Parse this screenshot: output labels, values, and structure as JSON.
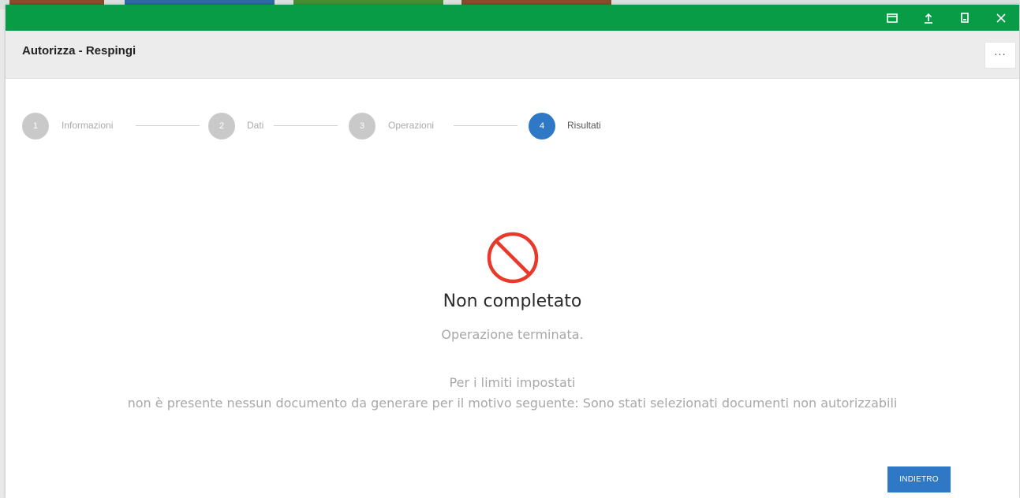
{
  "window": {
    "title": "Autorizza - Respingi",
    "controls": [
      {
        "icon": "restore-icon"
      },
      {
        "icon": "upload-icon"
      },
      {
        "icon": "minimize-icon"
      },
      {
        "icon": "close-icon"
      }
    ],
    "more_label": "···",
    "titlebar_color": "#089c47"
  },
  "stepper": {
    "steps": [
      {
        "number": "1",
        "label": "Informazioni",
        "state": "done"
      },
      {
        "number": "2",
        "label": "Dati",
        "state": "done"
      },
      {
        "number": "3",
        "label": "Operazioni",
        "state": "done"
      },
      {
        "number": "4",
        "label": "Risultati",
        "state": "active"
      }
    ],
    "active_color": "#2e78c6",
    "inactive_color": "#c9c9c9"
  },
  "result": {
    "icon": "prohibited-icon",
    "icon_color": "#e8392b",
    "title": "Non completato",
    "subtitle": "Operazione terminata.",
    "message_line1": "Per i limiti impostati",
    "message_line2": "non è presente nessun documento da generare per il motivo seguente: Sono stati selezionati documenti non autorizzabili"
  },
  "footer": {
    "back_label": "INDIETRO"
  }
}
